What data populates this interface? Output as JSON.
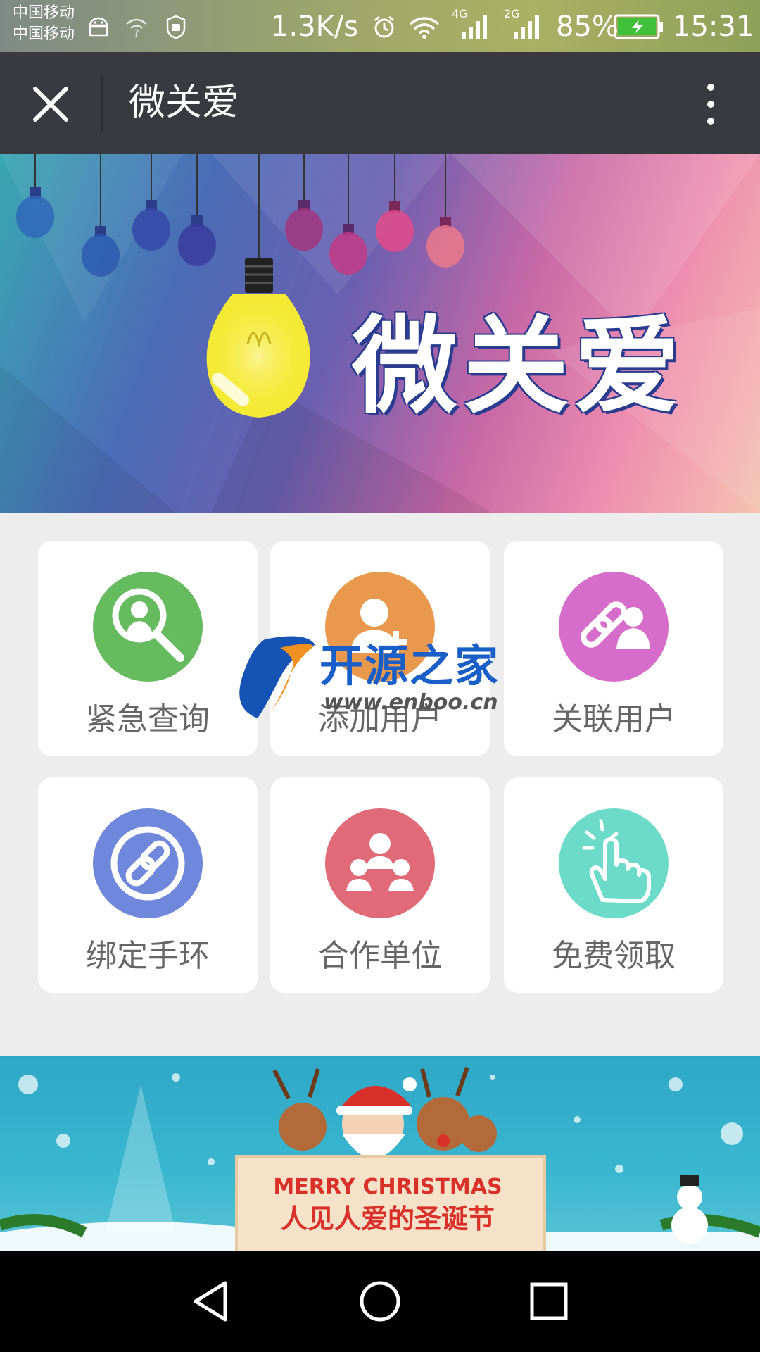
{
  "status_bar": {
    "carrier_1": "中国移动",
    "carrier_2": "中国移动",
    "speed": "1.3K/s",
    "network_1": "4G",
    "network_2": "2G",
    "battery": "85%",
    "time": "15:31"
  },
  "nav": {
    "title": "微关爱",
    "close_icon": "close-icon",
    "more_icon": "more-vertical-icon"
  },
  "banner": {
    "title": "微关爱"
  },
  "grid": {
    "items": [
      {
        "label": "紧急查询",
        "icon": "search-user-icon",
        "color": "#66bb5e"
      },
      {
        "label": "添加用户",
        "icon": "add-user-icon",
        "color": "#e8994e"
      },
      {
        "label": "关联用户",
        "icon": "link-users-icon",
        "color": "#d66dcb"
      },
      {
        "label": "绑定手环",
        "icon": "bind-link-icon",
        "color": "#6f88db"
      },
      {
        "label": "合作单位",
        "icon": "group-icon",
        "color": "#e06a78"
      },
      {
        "label": "免费领取",
        "icon": "tap-hand-icon",
        "color": "#6ddbc9"
      }
    ]
  },
  "watermark": {
    "title": "开源之家",
    "url": "www.enboo.cn"
  },
  "christmas_banner": {
    "english": "MERRY CHRISTMAS",
    "chinese": "人见人爱的圣诞节"
  },
  "system_nav": {
    "back": "back-icon",
    "home": "home-icon",
    "recents": "recents-icon"
  }
}
